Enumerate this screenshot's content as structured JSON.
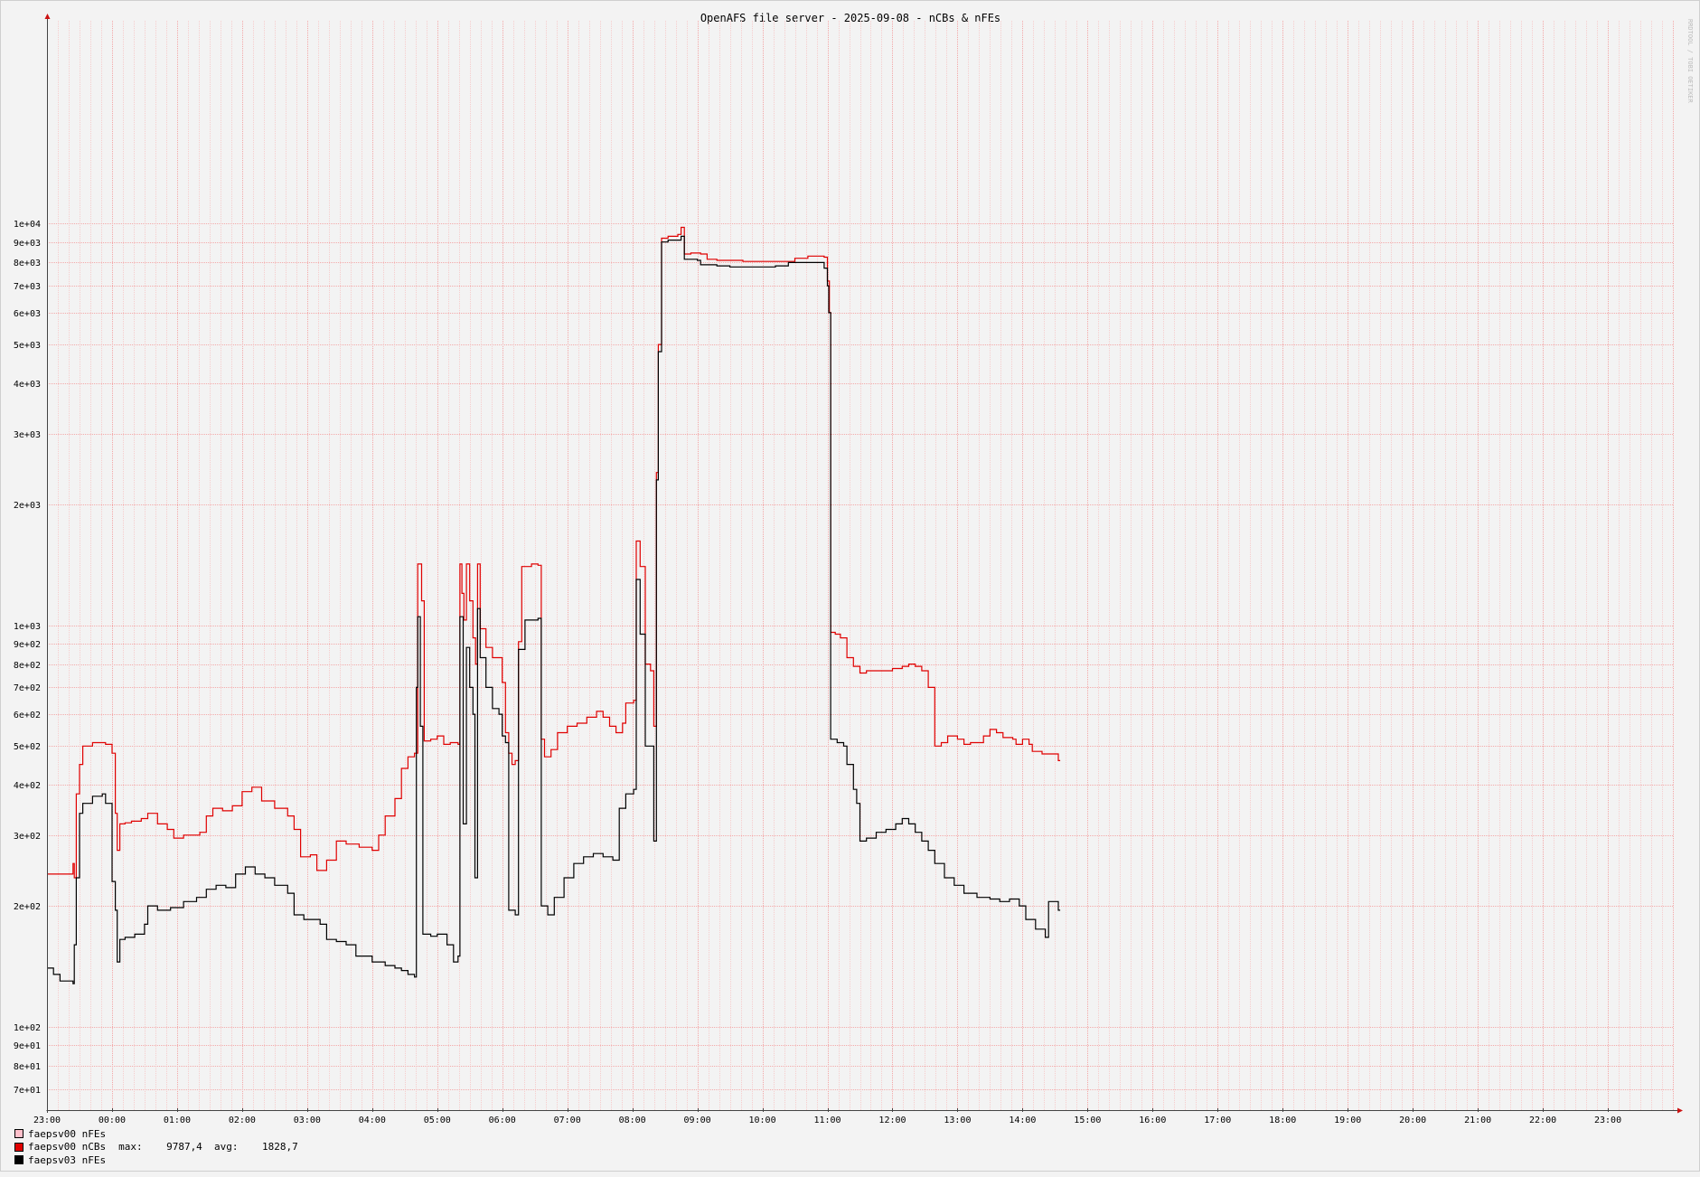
{
  "chart_data": {
    "type": "line",
    "title": "OpenAFS file server - 2025-09-08 - nCBs & nFEs",
    "watermark": "RRDTOOL / TOBI OETIKER",
    "y_scale": "log",
    "ylim": [
      62,
      32000
    ],
    "y_ticks": [
      {
        "value": 10000,
        "label": "1e+04"
      },
      {
        "value": 9000,
        "label": "9e+03"
      },
      {
        "value": 8000,
        "label": "8e+03"
      },
      {
        "value": 7000,
        "label": "7e+03"
      },
      {
        "value": 6000,
        "label": "6e+03"
      },
      {
        "value": 5000,
        "label": "5e+03"
      },
      {
        "value": 4000,
        "label": "4e+03"
      },
      {
        "value": 3000,
        "label": "3e+03"
      },
      {
        "value": 2000,
        "label": "2e+03"
      },
      {
        "value": 1000,
        "label": "1e+03"
      },
      {
        "value": 900,
        "label": "9e+02"
      },
      {
        "value": 800,
        "label": "8e+02"
      },
      {
        "value": 700,
        "label": "7e+02"
      },
      {
        "value": 600,
        "label": "6e+02"
      },
      {
        "value": 500,
        "label": "5e+02"
      },
      {
        "value": 400,
        "label": "4e+02"
      },
      {
        "value": 300,
        "label": "3e+02"
      },
      {
        "value": 200,
        "label": "2e+02"
      },
      {
        "value": 100,
        "label": "1e+02"
      },
      {
        "value": 90,
        "label": "9e+01"
      },
      {
        "value": 80,
        "label": "8e+01"
      },
      {
        "value": 70,
        "label": "7e+01"
      }
    ],
    "x_ticks": [
      "23:00",
      "00:00",
      "01:00",
      "02:00",
      "03:00",
      "04:00",
      "05:00",
      "06:00",
      "07:00",
      "08:00",
      "09:00",
      "10:00",
      "11:00",
      "12:00",
      "13:00",
      "14:00",
      "15:00",
      "16:00",
      "17:00",
      "18:00",
      "19:00",
      "20:00",
      "21:00",
      "22:00",
      "23:00"
    ],
    "xlim": [
      "23:00",
      "24:59"
    ],
    "grid": true,
    "legend_position": "bottom-left",
    "series": [
      {
        "name": "faepsv00 nFEs",
        "color": "#ffc0cb",
        "values": []
      },
      {
        "name": "faepsv00 nCBs",
        "color": "#e00000",
        "stats": "max:    9787,4  avg:    1828,7",
        "values": [
          [
            -1.0,
            240
          ],
          [
            -0.6,
            255
          ],
          [
            -0.58,
            235
          ],
          [
            -0.55,
            380
          ],
          [
            -0.5,
            450
          ],
          [
            -0.45,
            500
          ],
          [
            -0.3,
            510
          ],
          [
            -0.1,
            505
          ],
          [
            0.0,
            480
          ],
          [
            0.05,
            340
          ],
          [
            0.08,
            275
          ],
          [
            0.12,
            320
          ],
          [
            0.2,
            322
          ],
          [
            0.3,
            325
          ],
          [
            0.45,
            330
          ],
          [
            0.55,
            340
          ],
          [
            0.7,
            320
          ],
          [
            0.85,
            310
          ],
          [
            0.95,
            295
          ],
          [
            1.1,
            300
          ],
          [
            1.25,
            300
          ],
          [
            1.35,
            305
          ],
          [
            1.45,
            335
          ],
          [
            1.55,
            350
          ],
          [
            1.7,
            345
          ],
          [
            1.85,
            355
          ],
          [
            2.0,
            385
          ],
          [
            2.15,
            395
          ],
          [
            2.3,
            365
          ],
          [
            2.5,
            350
          ],
          [
            2.7,
            335
          ],
          [
            2.8,
            310
          ],
          [
            2.9,
            265
          ],
          [
            3.05,
            268
          ],
          [
            3.15,
            245
          ],
          [
            3.3,
            260
          ],
          [
            3.45,
            290
          ],
          [
            3.6,
            285
          ],
          [
            3.8,
            280
          ],
          [
            4.0,
            275
          ],
          [
            4.1,
            300
          ],
          [
            4.2,
            335
          ],
          [
            4.35,
            370
          ],
          [
            4.45,
            440
          ],
          [
            4.55,
            470
          ],
          [
            4.65,
            480
          ],
          [
            4.7,
            1420
          ],
          [
            4.76,
            1150
          ],
          [
            4.8,
            515
          ],
          [
            4.9,
            520
          ],
          [
            5.0,
            530
          ],
          [
            5.1,
            505
          ],
          [
            5.2,
            510
          ],
          [
            5.32,
            505
          ],
          [
            5.35,
            1420
          ],
          [
            5.38,
            1200
          ],
          [
            5.41,
            1030
          ],
          [
            5.45,
            1420
          ],
          [
            5.5,
            1150
          ],
          [
            5.55,
            930
          ],
          [
            5.59,
            800
          ],
          [
            5.62,
            1420
          ],
          [
            5.66,
            980
          ],
          [
            5.75,
            880
          ],
          [
            5.85,
            830
          ],
          [
            5.95,
            830
          ],
          [
            6.0,
            720
          ],
          [
            6.05,
            540
          ],
          [
            6.1,
            480
          ],
          [
            6.15,
            450
          ],
          [
            6.2,
            460
          ],
          [
            6.25,
            910
          ],
          [
            6.3,
            1400
          ],
          [
            6.45,
            1420
          ],
          [
            6.55,
            1410
          ],
          [
            6.6,
            520
          ],
          [
            6.65,
            470
          ],
          [
            6.75,
            490
          ],
          [
            6.85,
            540
          ],
          [
            7.0,
            560
          ],
          [
            7.15,
            570
          ],
          [
            7.3,
            590
          ],
          [
            7.45,
            610
          ],
          [
            7.55,
            590
          ],
          [
            7.65,
            560
          ],
          [
            7.75,
            540
          ],
          [
            7.85,
            570
          ],
          [
            7.9,
            640
          ],
          [
            8.02,
            650
          ],
          [
            8.06,
            1620
          ],
          [
            8.12,
            1400
          ],
          [
            8.2,
            800
          ],
          [
            8.28,
            770
          ],
          [
            8.33,
            560
          ],
          [
            8.37,
            2400
          ],
          [
            8.4,
            5000
          ],
          [
            8.45,
            9200
          ],
          [
            8.55,
            9300
          ],
          [
            8.7,
            9400
          ],
          [
            8.75,
            9787
          ],
          [
            8.8,
            8400
          ],
          [
            8.9,
            8450
          ],
          [
            9.05,
            8400
          ],
          [
            9.15,
            8150
          ],
          [
            9.3,
            8100
          ],
          [
            9.5,
            8100
          ],
          [
            9.7,
            8050
          ],
          [
            10.0,
            8050
          ],
          [
            10.2,
            8050
          ],
          [
            10.5,
            8200
          ],
          [
            10.7,
            8300
          ],
          [
            10.95,
            8250
          ],
          [
            11.0,
            7200
          ],
          [
            11.03,
            6000
          ],
          [
            11.05,
            960
          ],
          [
            11.12,
            950
          ],
          [
            11.2,
            930
          ],
          [
            11.3,
            830
          ],
          [
            11.4,
            790
          ],
          [
            11.5,
            760
          ],
          [
            11.6,
            770
          ],
          [
            11.8,
            770
          ],
          [
            12.0,
            780
          ],
          [
            12.15,
            790
          ],
          [
            12.25,
            800
          ],
          [
            12.35,
            790
          ],
          [
            12.45,
            770
          ],
          [
            12.55,
            700
          ],
          [
            12.65,
            500
          ],
          [
            12.75,
            510
          ],
          [
            12.85,
            530
          ],
          [
            13.0,
            520
          ],
          [
            13.1,
            505
          ],
          [
            13.2,
            510
          ],
          [
            13.4,
            530
          ],
          [
            13.5,
            550
          ],
          [
            13.6,
            540
          ],
          [
            13.7,
            525
          ],
          [
            13.85,
            520
          ],
          [
            13.9,
            505
          ],
          [
            14.0,
            520
          ],
          [
            14.1,
            505
          ],
          [
            14.15,
            485
          ],
          [
            14.3,
            478
          ],
          [
            14.55,
            460
          ]
        ]
      },
      {
        "name": "faepsv03 nFEs",
        "color": "#000000",
        "values": [
          [
            -1.0,
            140
          ],
          [
            -0.9,
            135
          ],
          [
            -0.8,
            130
          ],
          [
            -0.6,
            128
          ],
          [
            -0.58,
            160
          ],
          [
            -0.55,
            235
          ],
          [
            -0.5,
            340
          ],
          [
            -0.45,
            360
          ],
          [
            -0.3,
            375
          ],
          [
            -0.15,
            380
          ],
          [
            -0.1,
            360
          ],
          [
            0.0,
            230
          ],
          [
            0.05,
            195
          ],
          [
            0.08,
            145
          ],
          [
            0.12,
            165
          ],
          [
            0.2,
            167
          ],
          [
            0.35,
            170
          ],
          [
            0.5,
            180
          ],
          [
            0.55,
            200
          ],
          [
            0.7,
            195
          ],
          [
            0.9,
            198
          ],
          [
            1.1,
            205
          ],
          [
            1.3,
            210
          ],
          [
            1.45,
            220
          ],
          [
            1.6,
            225
          ],
          [
            1.75,
            222
          ],
          [
            1.9,
            240
          ],
          [
            2.05,
            250
          ],
          [
            2.2,
            240
          ],
          [
            2.35,
            235
          ],
          [
            2.5,
            225
          ],
          [
            2.7,
            215
          ],
          [
            2.8,
            190
          ],
          [
            2.95,
            185
          ],
          [
            3.05,
            185
          ],
          [
            3.2,
            180
          ],
          [
            3.3,
            165
          ],
          [
            3.45,
            163
          ],
          [
            3.6,
            160
          ],
          [
            3.75,
            150
          ],
          [
            3.85,
            150
          ],
          [
            4.0,
            145
          ],
          [
            4.2,
            142
          ],
          [
            4.35,
            140
          ],
          [
            4.45,
            138
          ],
          [
            4.55,
            135
          ],
          [
            4.65,
            133
          ],
          [
            4.68,
            700
          ],
          [
            4.7,
            1050
          ],
          [
            4.74,
            560
          ],
          [
            4.78,
            170
          ],
          [
            4.9,
            168
          ],
          [
            5.0,
            170
          ],
          [
            5.15,
            160
          ],
          [
            5.25,
            145
          ],
          [
            5.32,
            150
          ],
          [
            5.35,
            1050
          ],
          [
            5.4,
            320
          ],
          [
            5.45,
            880
          ],
          [
            5.5,
            700
          ],
          [
            5.55,
            600
          ],
          [
            5.58,
            235
          ],
          [
            5.62,
            1100
          ],
          [
            5.66,
            830
          ],
          [
            5.75,
            700
          ],
          [
            5.85,
            620
          ],
          [
            5.95,
            600
          ],
          [
            6.0,
            530
          ],
          [
            6.05,
            510
          ],
          [
            6.1,
            195
          ],
          [
            6.2,
            190
          ],
          [
            6.25,
            870
          ],
          [
            6.35,
            1030
          ],
          [
            6.55,
            1040
          ],
          [
            6.6,
            200
          ],
          [
            6.7,
            190
          ],
          [
            6.8,
            210
          ],
          [
            6.95,
            235
          ],
          [
            7.1,
            255
          ],
          [
            7.25,
            265
          ],
          [
            7.4,
            270
          ],
          [
            7.55,
            265
          ],
          [
            7.7,
            260
          ],
          [
            7.8,
            350
          ],
          [
            7.9,
            380
          ],
          [
            8.02,
            390
          ],
          [
            8.06,
            1300
          ],
          [
            8.12,
            950
          ],
          [
            8.2,
            500
          ],
          [
            8.28,
            500
          ],
          [
            8.33,
            290
          ],
          [
            8.37,
            2300
          ],
          [
            8.4,
            4800
          ],
          [
            8.45,
            9000
          ],
          [
            8.55,
            9100
          ],
          [
            8.7,
            9100
          ],
          [
            8.75,
            9300
          ],
          [
            8.8,
            8150
          ],
          [
            9.0,
            8100
          ],
          [
            9.05,
            7900
          ],
          [
            9.3,
            7850
          ],
          [
            9.5,
            7800
          ],
          [
            9.8,
            7800
          ],
          [
            10.0,
            7800
          ],
          [
            10.2,
            7850
          ],
          [
            10.4,
            8000
          ],
          [
            10.6,
            8000
          ],
          [
            10.85,
            8000
          ],
          [
            10.95,
            7750
          ],
          [
            11.0,
            7000
          ],
          [
            11.02,
            6000
          ],
          [
            11.05,
            520
          ],
          [
            11.15,
            510
          ],
          [
            11.25,
            500
          ],
          [
            11.3,
            450
          ],
          [
            11.4,
            390
          ],
          [
            11.45,
            360
          ],
          [
            11.5,
            290
          ],
          [
            11.6,
            295
          ],
          [
            11.75,
            305
          ],
          [
            11.9,
            310
          ],
          [
            12.05,
            320
          ],
          [
            12.15,
            330
          ],
          [
            12.25,
            320
          ],
          [
            12.35,
            305
          ],
          [
            12.45,
            290
          ],
          [
            12.55,
            275
          ],
          [
            12.65,
            255
          ],
          [
            12.8,
            235
          ],
          [
            12.95,
            225
          ],
          [
            13.1,
            215
          ],
          [
            13.3,
            210
          ],
          [
            13.5,
            208
          ],
          [
            13.65,
            205
          ],
          [
            13.8,
            208
          ],
          [
            13.95,
            200
          ],
          [
            14.05,
            185
          ],
          [
            14.2,
            175
          ],
          [
            14.35,
            167
          ],
          [
            14.4,
            205
          ],
          [
            14.55,
            195
          ]
        ]
      }
    ]
  }
}
